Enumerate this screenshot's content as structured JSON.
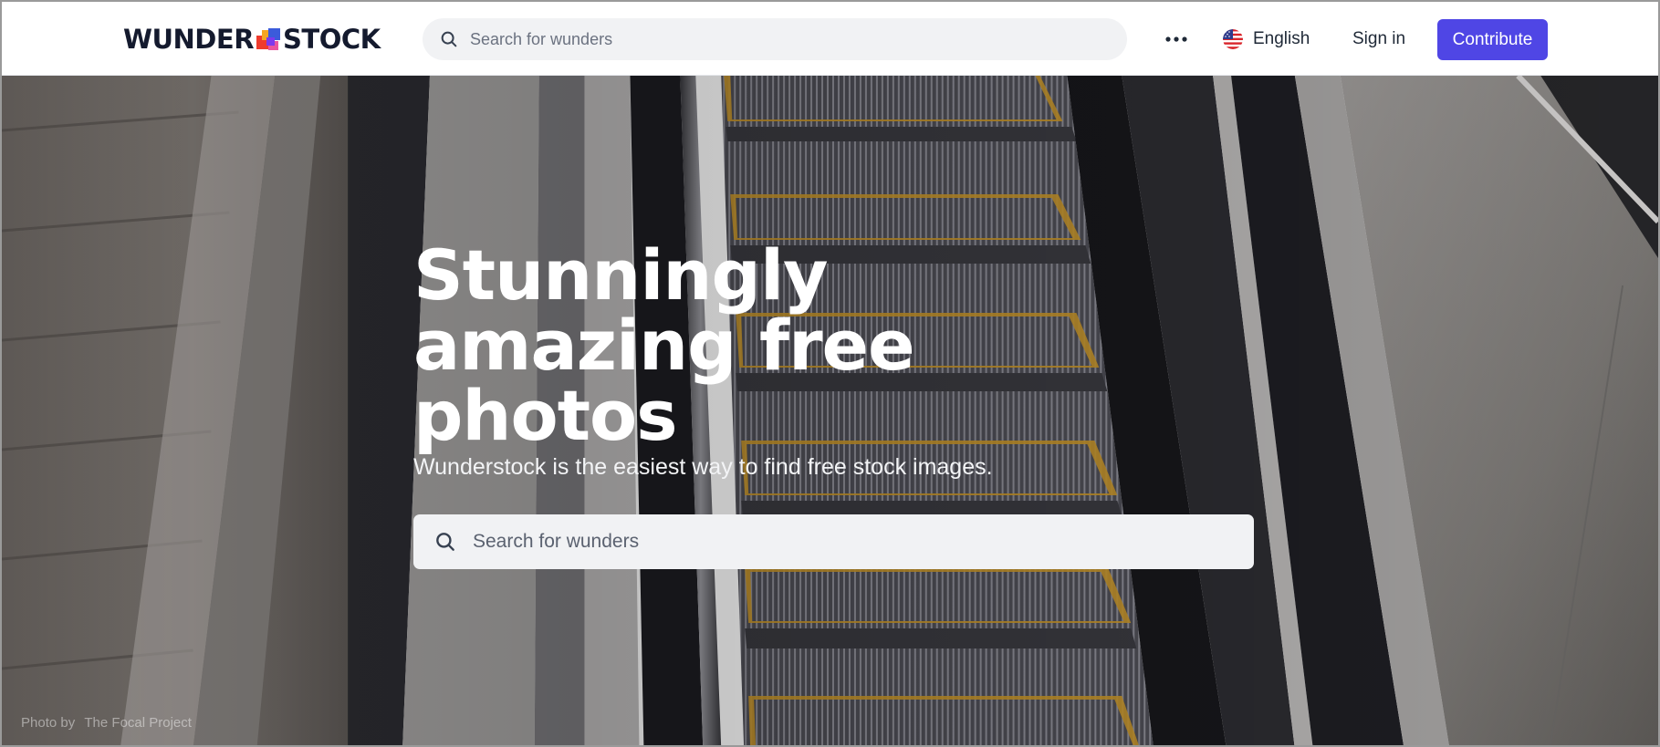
{
  "header": {
    "logo_left": "WUNDER",
    "logo_right": "STOCK",
    "search_placeholder": "Search for wunders",
    "more_icon": "ellipsis-icon",
    "language_label": "English",
    "language_flag": "us-flag-icon",
    "signin_label": "Sign in",
    "contribute_label": "Contribute"
  },
  "hero": {
    "headline": "Stunningly amazing free photos",
    "tagline": "Wunderstock is the easiest way to find free stock images.",
    "search_placeholder": "Search for wunders",
    "credit_prefix": "Photo by",
    "credit_author": "The Focal Project"
  },
  "colors": {
    "accent": "#4f46e5",
    "logo_text": "#141a2e",
    "search_bg": "#f1f2f4"
  }
}
